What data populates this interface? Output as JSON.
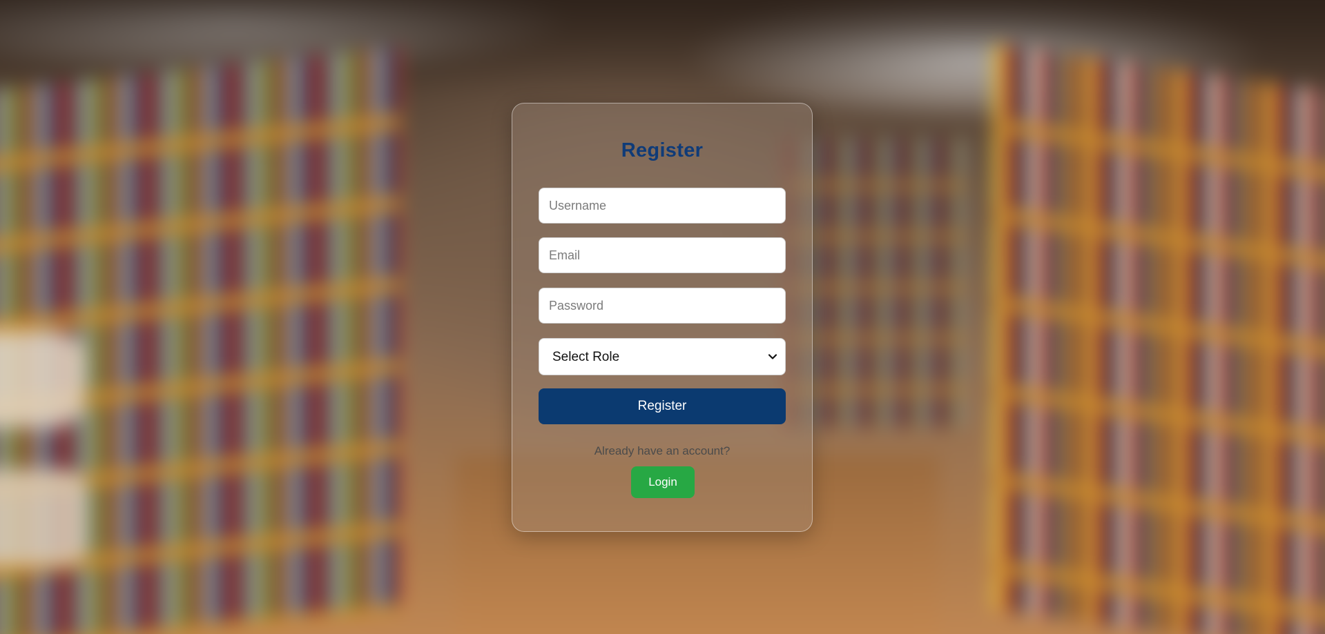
{
  "form": {
    "title": "Register",
    "username_placeholder": "Username",
    "email_placeholder": "Email",
    "password_placeholder": "Password",
    "role_select": {
      "selected": "Select Role"
    },
    "register_label": "Register",
    "account_prompt": "Already have an account?",
    "login_label": "Login"
  },
  "colors": {
    "title": "#0f3b78",
    "register_button": "#0b3a70",
    "login_button": "#27a844"
  },
  "icons": {
    "role_select": "chevron-down-icon"
  }
}
